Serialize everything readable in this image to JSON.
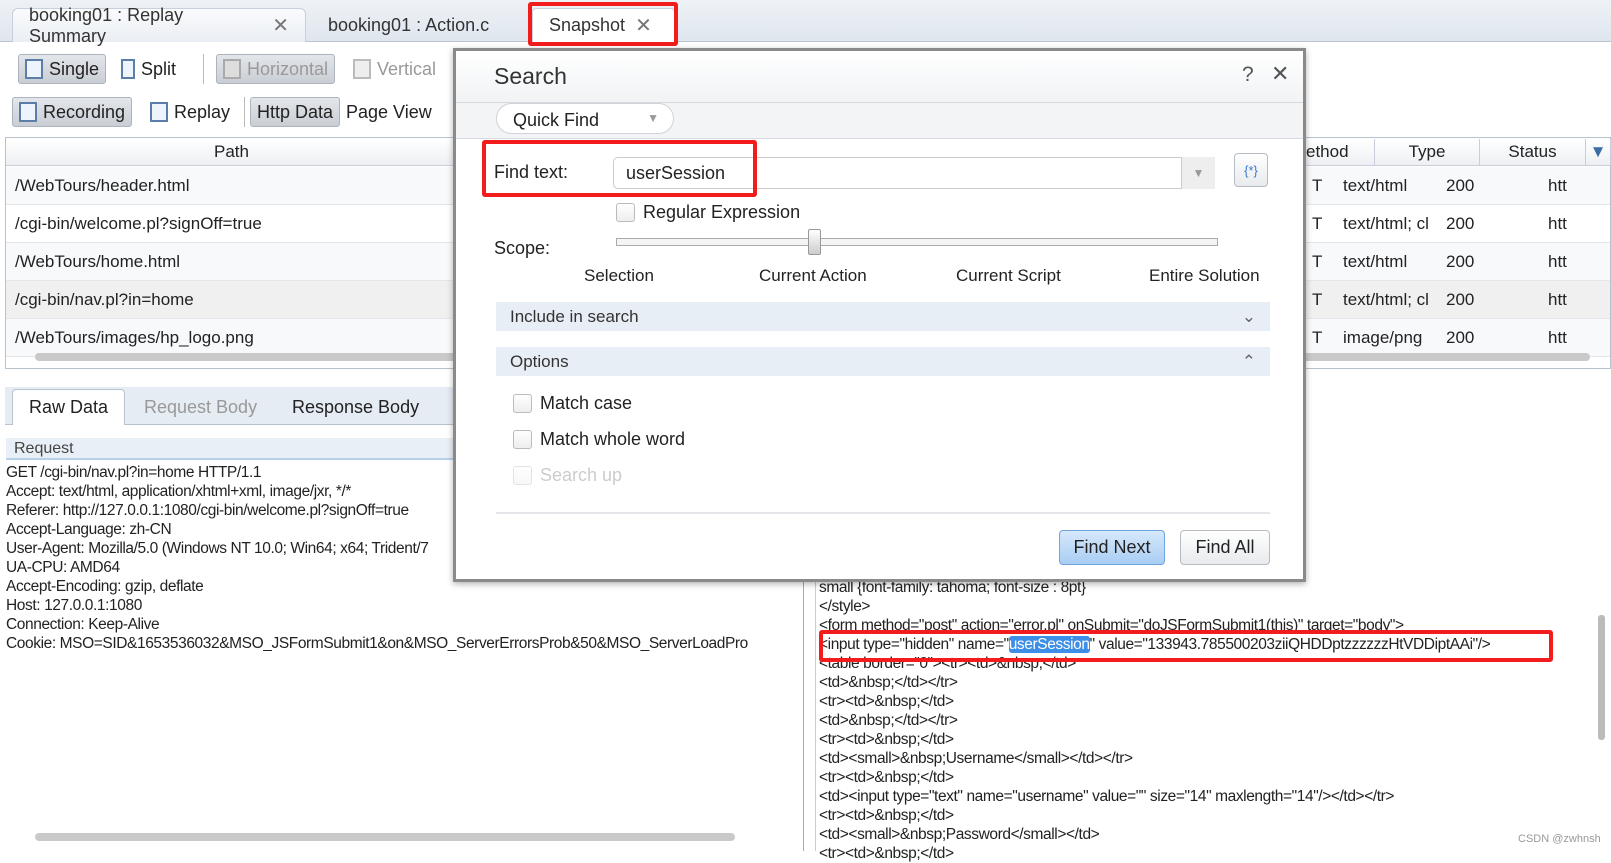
{
  "tabs": [
    {
      "label": "booking01 : Replay Summary",
      "closable": true
    },
    {
      "label": "booking01 : Action.c",
      "closable": false
    },
    {
      "label": "Snapshot",
      "closable": true
    }
  ],
  "toolbar": {
    "single": "Single",
    "split": "Split",
    "horizontal": "Horizontal",
    "vertical": "Vertical",
    "recording": "Recording",
    "replay": "Replay",
    "http_data": "Http Data",
    "page_view": "Page View"
  },
  "grid": {
    "columns": {
      "path": "Path",
      "method": "ethod",
      "type": "Type",
      "status": "Status"
    },
    "rows": [
      {
        "path": "/WebTours/header.html",
        "method": "T",
        "type": "text/html",
        "status": "200",
        "url": "htt"
      },
      {
        "path": "/cgi-bin/welcome.pl?signOff=true",
        "method": "T",
        "type": "text/html; cl",
        "status": "200",
        "url": "htt"
      },
      {
        "path": "/WebTours/home.html",
        "method": "T",
        "type": "text/html",
        "status": "200",
        "url": "htt"
      },
      {
        "path": "/cgi-bin/nav.pl?in=home",
        "method": "T",
        "type": "text/html; cl",
        "status": "200",
        "url": "htt"
      },
      {
        "path": "/WebTours/images/hp_logo.png",
        "method": "T",
        "type": "image/png",
        "status": "200",
        "url": "htt"
      }
    ]
  },
  "bottom_tabs": {
    "raw": "Raw Data",
    "request_body": "Request Body",
    "response_body": "Response Body"
  },
  "request": {
    "header": "Request",
    "lines": [
      "GET /cgi-bin/nav.pl?in=home HTTP/1.1",
      "Accept: text/html, application/xhtml+xml, image/jxr, */*",
      "Referer: http://127.0.0.1:1080/cgi-bin/welcome.pl?signOff=true",
      "Accept-Language: zh-CN",
      "User-Agent: Mozilla/5.0 (Windows NT 10.0; Win64; x64; Trident/7",
      "UA-CPU: AMD64",
      "Accept-Encoding: gzip, deflate",
      "Host: 127.0.0.1:1080",
      "Connection: Keep-Alive",
      "Cookie: MSO=SID&1653536032&MSO_JSFormSubmit1&on&MSO_ServerErrorsProb&50&MSO_ServerLoadPro"
    ]
  },
  "response": {
    "lines_before": [
      "small {font-family: tahoma; font-size : 8pt}",
      "</style>",
      "<form method=\"post\" action=\"error.pl\"  onSubmit=\"doJSFormSubmit1(this)\" target=\"body\">"
    ],
    "match_prefix": "<input type=\"hidden\" name=\"",
    "match": "userSession",
    "match_suffix": "\" value=\"133943.785500203ziiQHDDptzzzzzzHtVDDiptAAi\"/>",
    "lines_after": [
      "<table border=\"0\"><tr><td>&nbsp;</td>",
      "<td>&nbsp;</td></tr>",
      "<tr><td>&nbsp;</td>",
      "<td>&nbsp;</td></tr>",
      "<tr><td>&nbsp;</td>",
      "<td><small>&nbsp;Username</small></td></tr>",
      "<tr><td>&nbsp;</td>",
      "<td><input type=\"text\" name=\"username\" value=\"\" size=\"14\" maxlength=\"14\"/></td></tr>",
      "<tr><td>&nbsp;</td>",
      "<td><small>&nbsp;Password</small></td>",
      "<tr><td>&nbsp;</td>"
    ]
  },
  "search": {
    "title": "Search",
    "help": "?",
    "mode": "Quick Find",
    "find_label": "Find text:",
    "find_value": "userSession",
    "regex_label": "Regular Expression",
    "scope_label": "Scope:",
    "scope_options": [
      "Selection",
      "Current Action",
      "Current Script",
      "Entire Solution"
    ],
    "scope_selected": "Current Action",
    "include_label": "Include in search",
    "options_label": "Options",
    "match_case": "Match case",
    "whole_word": "Match whole word",
    "search_up": "Search up",
    "find_next": "Find Next",
    "find_all": "Find All"
  },
  "watermark": "CSDN @zwhnsh",
  "colors": {
    "highlight": "#f21c1c",
    "selection": "#3d8ee6",
    "accent_button": "#b9d6f5"
  }
}
